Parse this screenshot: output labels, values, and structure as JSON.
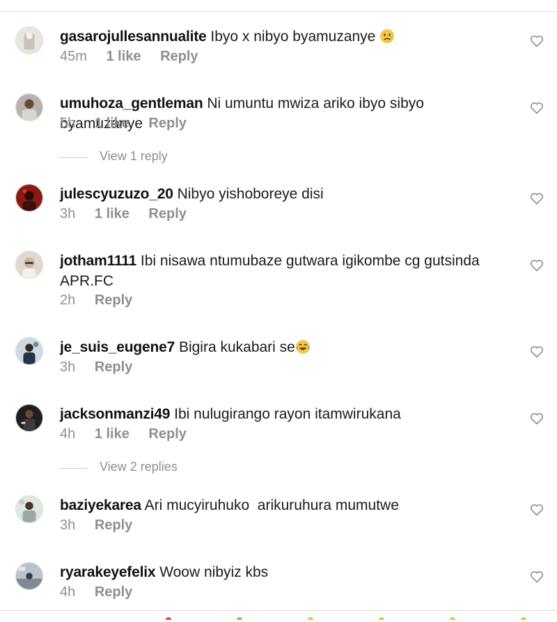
{
  "comments": [
    {
      "username": "gasarojullesannualite",
      "text": "Ibyo x nibyo byamuzanye",
      "emoji": "crying-face",
      "time": "45m",
      "likes": "1 like",
      "reply": "Reply",
      "avatar_color": "#c9c2b6"
    },
    {
      "username": "umuhoza_gentleman",
      "text": "Ni umuntu mwiza ariko ibyo sibyo byamuzanye",
      "time": "5h",
      "likes": "1 like",
      "reply": "Reply",
      "avatar_color": "#8f8a86"
    },
    {
      "username": "julescyuzuzo_20",
      "text": "Nibyo yishoboreye disi",
      "time": "3h",
      "likes": "1 like",
      "reply": "Reply",
      "avatar_color": "#8b1a14"
    },
    {
      "username": "jotham1111",
      "text": "Ibi nisawa ntumubaze gutwara igikombe cg gutsinda APR.FC",
      "time": "2h",
      "reply": "Reply",
      "avatar_color": "#c7b7a8"
    },
    {
      "username": "je_suis_eugene7",
      "text": "Bigira kukabari se",
      "emoji": "laughing-face",
      "time": "3h",
      "reply": "Reply",
      "avatar_color": "#6f8aa0"
    },
    {
      "username": "jacksonmanzi49",
      "text": "Ibi nulugirango rayon itamwirukana",
      "time": "4h",
      "likes": "1 like",
      "reply": "Reply",
      "avatar_color": "#2b2b2b"
    },
    {
      "username": "baziyekarea",
      "text": "Ari mucyiruhuko  arikuruhura mumutwe",
      "time": "3h",
      "reply": "Reply",
      "avatar_color": "#9aa9a3"
    },
    {
      "username": "ryarakeyefelix",
      "text": "Woow nibyiz kbs",
      "time": "4h",
      "reply": "Reply",
      "avatar_color": "#7f8a94"
    }
  ],
  "view_replies": [
    {
      "label": "View 1 reply"
    },
    {
      "label": "View 2 replies"
    }
  ],
  "colors": {
    "secondary_text": "#8e8e8e",
    "divider": "#e6e6e6",
    "heart_outline": "#8e8e8e"
  }
}
